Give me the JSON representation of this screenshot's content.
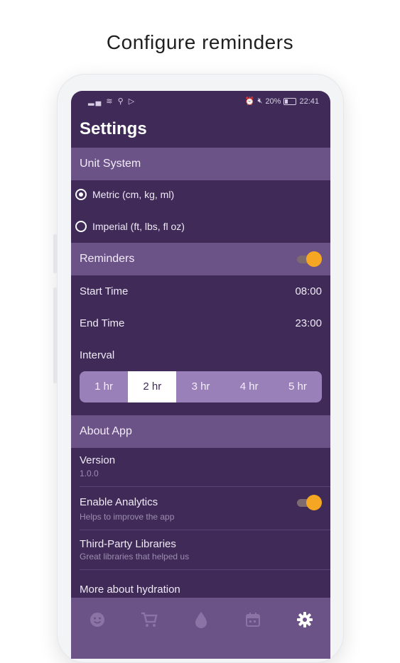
{
  "caption": "Configure reminders",
  "status_bar": {
    "left_icons": "signal wifi usb play",
    "battery": "20%",
    "time": "22:41"
  },
  "header": {
    "title": "Settings"
  },
  "unit_system": {
    "label": "Unit System",
    "options": [
      {
        "label": "Metric (cm, kg, ml)",
        "selected": true
      },
      {
        "label": "Imperial (ft, lbs, fl oz)",
        "selected": false
      }
    ]
  },
  "reminders": {
    "label": "Reminders",
    "enabled": true,
    "start_time": {
      "label": "Start Time",
      "value": "08:00"
    },
    "end_time": {
      "label": "End Time",
      "value": "23:00"
    },
    "interval": {
      "label": "Interval",
      "options": [
        "1 hr",
        "2 hr",
        "3 hr",
        "4 hr",
        "5 hr"
      ],
      "selected": "2 hr"
    }
  },
  "about": {
    "label": "About App",
    "version": {
      "title": "Version",
      "value": "1.0.0"
    },
    "analytics": {
      "title": "Enable Analytics",
      "subtitle": "Helps to improve the app",
      "enabled": true
    },
    "libraries": {
      "title": "Third-Party Libraries",
      "subtitle": "Great libraries that helped us"
    },
    "more": {
      "title": "More about hydration"
    }
  },
  "nav": {
    "items": [
      "face-icon",
      "cart-icon",
      "drop-icon",
      "calendar-icon",
      "gear-icon"
    ],
    "active": "gear-icon"
  },
  "colors": {
    "background": "#3f2a58",
    "section": "#6b5287",
    "accent": "#f5a623",
    "segment": "#9a80b8"
  }
}
